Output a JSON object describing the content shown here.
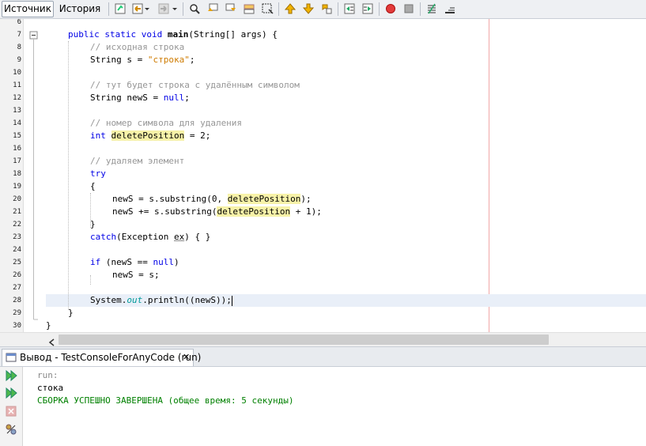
{
  "tabs": [
    {
      "label": "Источник",
      "active": true
    },
    {
      "label": "История",
      "active": false
    }
  ],
  "toolbar_icons": [
    "last-edit-icon",
    "back-icon",
    "dropdown-icon",
    "forward-icon",
    "dropdown-icon",
    "find-icon",
    "find-previous-icon",
    "find-next-icon",
    "find-selection-icon",
    "toggle-highlight-icon",
    "previous-bookmark-icon",
    "next-bookmark-icon",
    "toggle-bookmark-icon",
    "shift-left-icon",
    "shift-right-icon",
    "start-macro-icon",
    "stop-macro-icon",
    "comment-icon",
    "uncomment-icon"
  ],
  "editor": {
    "line_numbers": [
      "6",
      "7",
      "8",
      "9",
      "10",
      "11",
      "12",
      "13",
      "14",
      "15",
      "16",
      "17",
      "18",
      "19",
      "20",
      "21",
      "22",
      "23",
      "24",
      "25",
      "26",
      "27",
      "28",
      "29",
      "30"
    ],
    "code": {
      "l7": {
        "kw1": "public static void ",
        "name": "main",
        "rest": "(String[] args) {"
      },
      "l8": {
        "comment": "// исходная строка"
      },
      "l9": {
        "pre": "String s = ",
        "str": "\"строка\"",
        "post": ";"
      },
      "l11": {
        "comment": "// тут будет строка с удалённым символом"
      },
      "l12": {
        "pre": "String newS = ",
        "kw": "null",
        "post": ";"
      },
      "l14": {
        "comment": "// номер символа для удаления"
      },
      "l15": {
        "kw": "int ",
        "var": "deletePosition",
        "post": " = 2;"
      },
      "l17": {
        "comment": "// удаляем элемент"
      },
      "l18": {
        "kw": "try"
      },
      "l19": {
        "text": "{"
      },
      "l20": {
        "pre": "newS = s.substring(0, ",
        "var": "deletePosition",
        "post": ");"
      },
      "l21": {
        "pre": "newS += s.substring(",
        "var": "deletePosition",
        "post": " + 1);"
      },
      "l22": {
        "text": "}"
      },
      "l23": {
        "kw": "catch",
        "pre": "(Exception ",
        "ex": "ex",
        "post": ") { }"
      },
      "l25": {
        "kw1": "if ",
        "pre": "(newS == ",
        "kw2": "null",
        "post": ")"
      },
      "l26": {
        "text": "newS = s;"
      },
      "l28": {
        "pre": "System.",
        "field": "out",
        "post": ".println((newS));"
      },
      "l29": {
        "text": "}"
      },
      "l30": {
        "text": "}"
      }
    }
  },
  "output": {
    "tab_label": "Вывод - TestConsoleForAnyCode (run)",
    "close": "✕",
    "lines": {
      "run": "run:",
      "result": "стока",
      "build": "СБОРКА УСПЕШНО ЗАВЕРШЕНА (общее время: 5 секунды)"
    },
    "side_icons": [
      "rerun-icon",
      "rerun-with-options-icon",
      "stop-icon",
      "settings-icon"
    ]
  },
  "colors": {
    "keyword": "#0000e6",
    "comment": "#969696",
    "string": "#ce7b00",
    "field": "#009999",
    "build_success": "#008000",
    "highlight": "#f7f2a8",
    "margin": "#f0a8a8"
  }
}
